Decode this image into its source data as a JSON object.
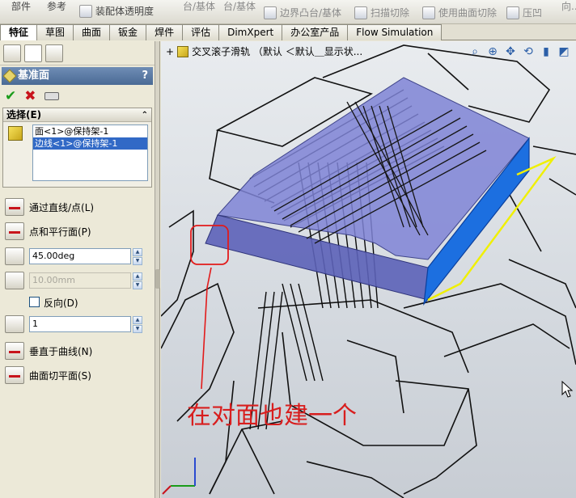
{
  "toolbar": {
    "items": [
      {
        "label": "部件",
        "dim": false
      },
      {
        "label": "参考",
        "dim": false
      },
      {
        "label": "装配体透明度",
        "dim": false
      },
      {
        "label": "台/基体",
        "dim": true
      },
      {
        "label": "台/基体",
        "dim": true
      },
      {
        "label": "边界凸台/基体",
        "dim": true
      },
      {
        "label": "扫描切除",
        "dim": true
      },
      {
        "label": "使用曲面切除",
        "dim": true
      },
      {
        "label": "压凹",
        "dim": true
      },
      {
        "label": "向...",
        "dim": true
      }
    ]
  },
  "tabs": [
    "特征",
    "草图",
    "曲面",
    "钣金",
    "焊件",
    "评估",
    "DimXpert",
    "办公室产品",
    "Flow Simulation"
  ],
  "active_tab": "特征",
  "property_manager": {
    "title": "基准面",
    "help": "?",
    "selection": {
      "header": "选择(E)",
      "items": [
        "面<1>@保持架-1",
        "边线<1>@保持架-1"
      ],
      "highlighted_index": 1
    },
    "options": {
      "through_line": "通过直线/点(L)",
      "parallel_plane": "点和平行面(P)",
      "angle_value": "45.00deg",
      "distance_value": "10.00mm",
      "reverse_label": "反向(D)",
      "count_value": "1",
      "normal_to_curve": "垂直于曲线(N)",
      "on_surface": "曲面切平面(S)"
    }
  },
  "viewport": {
    "tree_label": "交叉滚子滑轨 （默认 ＜默认＿显示状...",
    "annotation": "在对面也建一个",
    "colors": {
      "plane_face": "#7f84d6",
      "edge_highlight": "#1c6fe0",
      "sketch_line": "#f0f000",
      "annotation": "#d81e1e"
    }
  }
}
